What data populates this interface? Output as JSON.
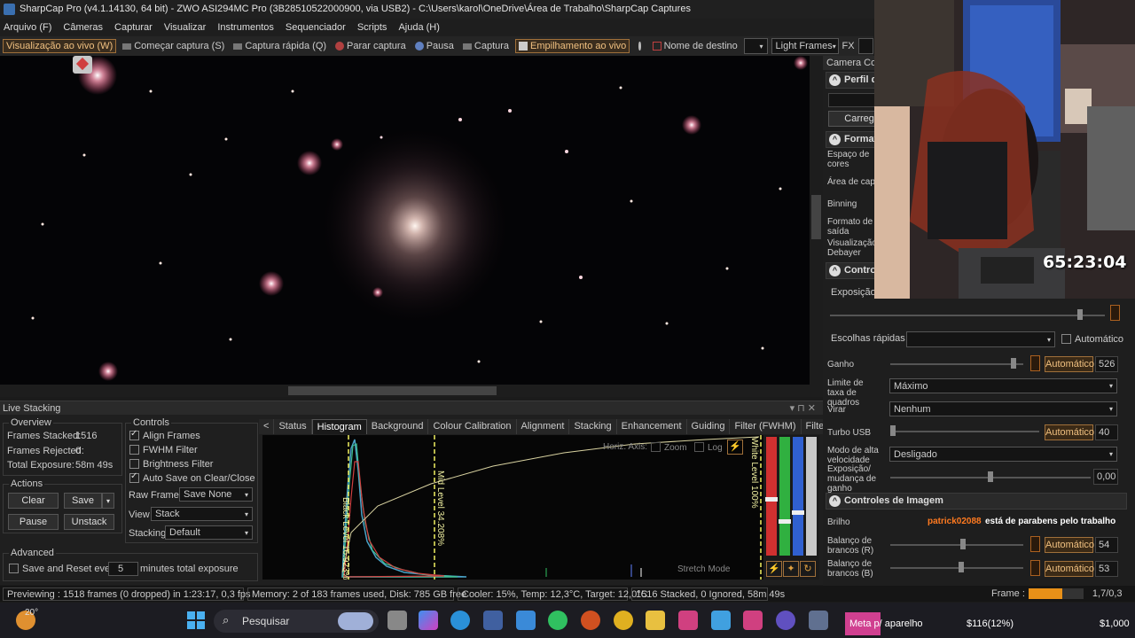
{
  "window": {
    "title": "SharpCap Pro (v4.1.14130, 64 bit) - ZWO ASI294MC Pro (3B28510522000900, via USB2) - C:\\Users\\karol\\OneDrive\\Área de Trabalho\\SharpCap Captures"
  },
  "menu": [
    "Arquivo (F)",
    "Câmeras",
    "Capturar",
    "Visualizar",
    "Instrumentos",
    "Sequenciador",
    "Scripts",
    "Ajuda (H)"
  ],
  "toolbar": {
    "live_view": "Visualização ao vivo (W)",
    "start_capture": "Começar captura (S)",
    "quick_capture": "Captura rápida (Q)",
    "stop_capture": "Parar captura",
    "pause": "Pausa",
    "capture": "Captura",
    "live_stack": "Empilhamento ao vivo",
    "target_name_label": "Nome de destino",
    "target_name_value": "",
    "frame_type": "Light Frames",
    "fx_label": "FX"
  },
  "live_stacking": {
    "header": "Live Stacking",
    "overview_title": "Overview",
    "frames_stacked_label": "Frames Stacked:",
    "frames_stacked": "1516",
    "frames_rejected_label": "Frames Rejected:",
    "frames_rejected": "0",
    "total_exposure_label": "Total Exposure:",
    "total_exposure": "58m 49s",
    "actions_title": "Actions",
    "clear": "Clear",
    "save": "Save",
    "pause": "Pause",
    "unstack": "Unstack",
    "advanced_title": "Advanced",
    "save_reset_label": "Save and Reset every",
    "save_reset_value": "5",
    "save_reset_suffix": "minutes total exposure",
    "controls_title": "Controls",
    "align_frames": "Align Frames",
    "fwhm_filter": "FWHM Filter",
    "brightness_filter": "Brightness Filter",
    "auto_save": "Auto Save on Clear/Close",
    "raw_frames_label": "Raw Frames",
    "raw_frames_value": "Save None",
    "view_label": "View",
    "view_value": "Stack",
    "stacking_label": "Stacking",
    "stacking_value": "Default",
    "tabs": [
      "Status",
      "Histogram",
      "Background",
      "Colour Calibration",
      "Alignment",
      "Stacking",
      "Enhancement",
      "Guiding",
      "Filter (FWHM)",
      "Filter (Brightness)"
    ],
    "histogram": {
      "horiz_axis": "Horiz. Axis:",
      "zoom": "Zoom",
      "log": "Log",
      "black_level": "Black Level 16.923%",
      "mid_level": "Mid Level 34.208%",
      "white_level": "White Level 100%",
      "stretch_mode": "Stretch Mode"
    }
  },
  "status_bar": {
    "previewing": "Previewing : 1518 frames (0 dropped) in 1:23:17, 0,3 fps",
    "memory": "Memory: 2 of 183 frames used, Disk: 785 GB free",
    "cooler": "Cooler: 15%, Temp: 12,3°C, Target: 12,0°C",
    "stacked": "1516 Stacked, 0 Ignored, 58m 49s",
    "frame_label": "Frame :",
    "frame_value": "1,7/0,3",
    "frame_progress": 0.62
  },
  "right_panel": {
    "camera_controls": "Camera Con",
    "profile": "Perfil d",
    "load": "Carregar",
    "format": "Format",
    "color_space": "Espaço de cores",
    "capture_area": "Área de capt",
    "binning": "Binning",
    "output_format": "Formato de saída",
    "debayer_preview": "Visualização Debayer",
    "controls": "Control",
    "exposure": "Exposição",
    "quick_picks": "Escolhas rápidas",
    "auto": "Automático",
    "gain_label": "Ganho",
    "gain_auto": "Automático",
    "gain_value": "526",
    "frame_rate_label": "Limite de taxa de quadros",
    "frame_rate_value": "Máximo",
    "flip_label": "Virar",
    "flip_value": "Nenhum",
    "usb_turbo_label": "Turbo USB",
    "usb_turbo_auto": "Automático",
    "usb_turbo_value": "40",
    "high_speed_label": "Modo de alta velocidade",
    "high_speed_value": "Desligado",
    "exp_gain_change": "Exposição/ mudança de ganho",
    "exp_gain_value": "0,00",
    "image_controls": "Controles de Imagem",
    "brightness_label": "Brilho",
    "wb_r_label": "Balanço de brancos (R)",
    "wb_r_auto": "Automático",
    "wb_r_value": "54",
    "wb_b_label": "Balanço de brancos (B)",
    "wb_b_auto": "Automático",
    "wb_b_value": "53"
  },
  "overlay": {
    "timer": "65:23:04",
    "chat_user": "patrick02088",
    "chat_message": "está de parabens pelo trabalho"
  },
  "taskbar": {
    "temperature": "20°",
    "search": "Pesquisar",
    "meta": "Meta p/ aparelho",
    "stock1": "$116(12%)",
    "stock2": "$1,000"
  }
}
